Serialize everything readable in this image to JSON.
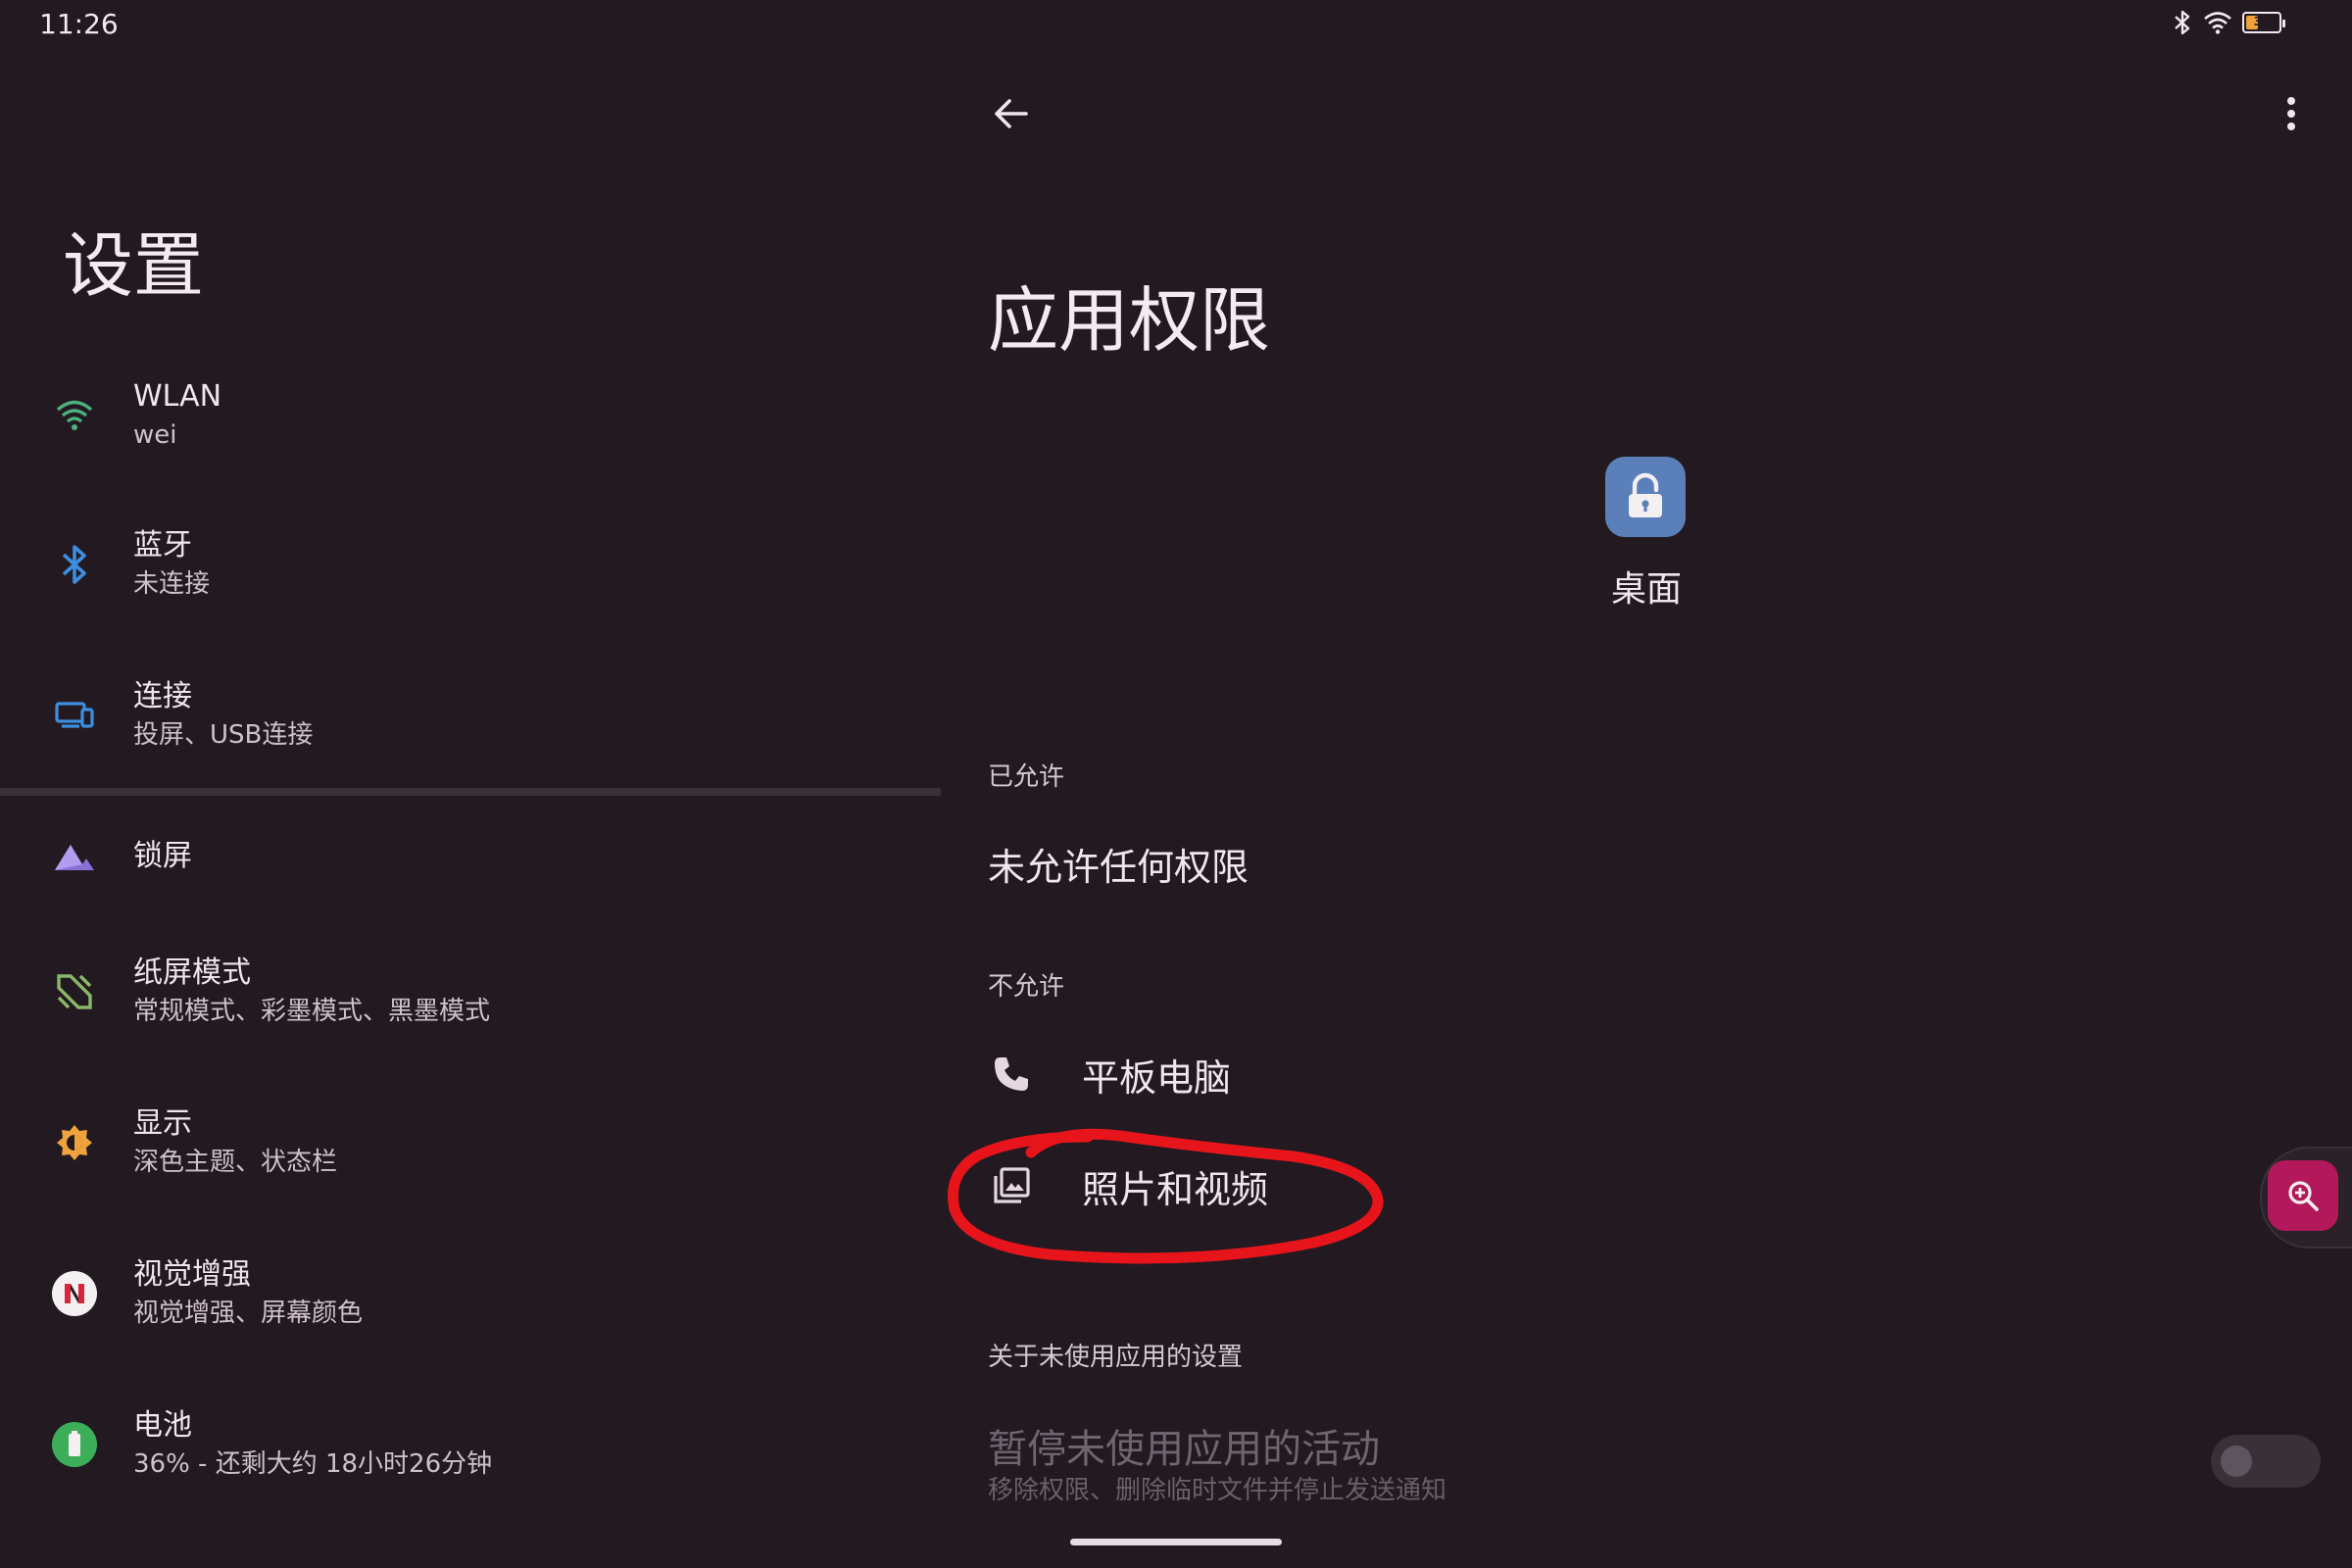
{
  "status_bar": {
    "time": "11:26",
    "battery_level": "36",
    "battery_fraction": 0.36
  },
  "left_pane": {
    "title": "设置",
    "items": [
      {
        "title": "WLAN",
        "subtitle": "wei",
        "icon": "wifi-icon",
        "color": "#4caf7e"
      },
      {
        "title": "蓝牙",
        "subtitle": "未连接",
        "icon": "bluetooth-icon",
        "color": "#3c8ee0"
      },
      {
        "title": "连接",
        "subtitle": "投屏、USB连接",
        "icon": "devices-icon",
        "color": "#3c8ee0"
      },
      {
        "title": "锁屏",
        "subtitle": "",
        "icon": "lockscreen-icon",
        "color": "#8a6fd6"
      },
      {
        "title": "纸屏模式",
        "subtitle": "常规模式、彩墨模式、黑墨模式",
        "icon": "paper-mode-icon",
        "color": "#8ab868"
      },
      {
        "title": "显示",
        "subtitle": "深色主题、状态栏",
        "icon": "display-icon",
        "color": "#f0a23c"
      },
      {
        "title": "视觉增强",
        "subtitle": "视觉增强、屏幕颜色",
        "icon": "visual-enhance-icon",
        "color": "#e04050"
      },
      {
        "title": "电池",
        "subtitle": "36% - 还剩大约 18小时26分钟",
        "icon": "battery-icon",
        "color": "#3cae5a"
      }
    ]
  },
  "right_pane": {
    "title": "应用权限",
    "app_name": "桌面",
    "app_icon_color": "#5b7fb9",
    "allowed_label": "已允许",
    "allowed_empty": "未允许任何权限",
    "denied_label": "不允许",
    "denied_items": [
      {
        "label": "平板电脑",
        "icon": "phone-icon"
      },
      {
        "label": "照片和视频",
        "icon": "photos-icon"
      }
    ],
    "unused_section_label": "关于未使用应用的设置",
    "unused_title": "暂停未使用应用的活动",
    "unused_subtitle": "移除权限、删除临时文件并停止发送通知",
    "unused_toggle_on": false
  },
  "colors": {
    "background": "#221a20",
    "annotation_red": "#e8141c",
    "fab": "#b3185a"
  }
}
